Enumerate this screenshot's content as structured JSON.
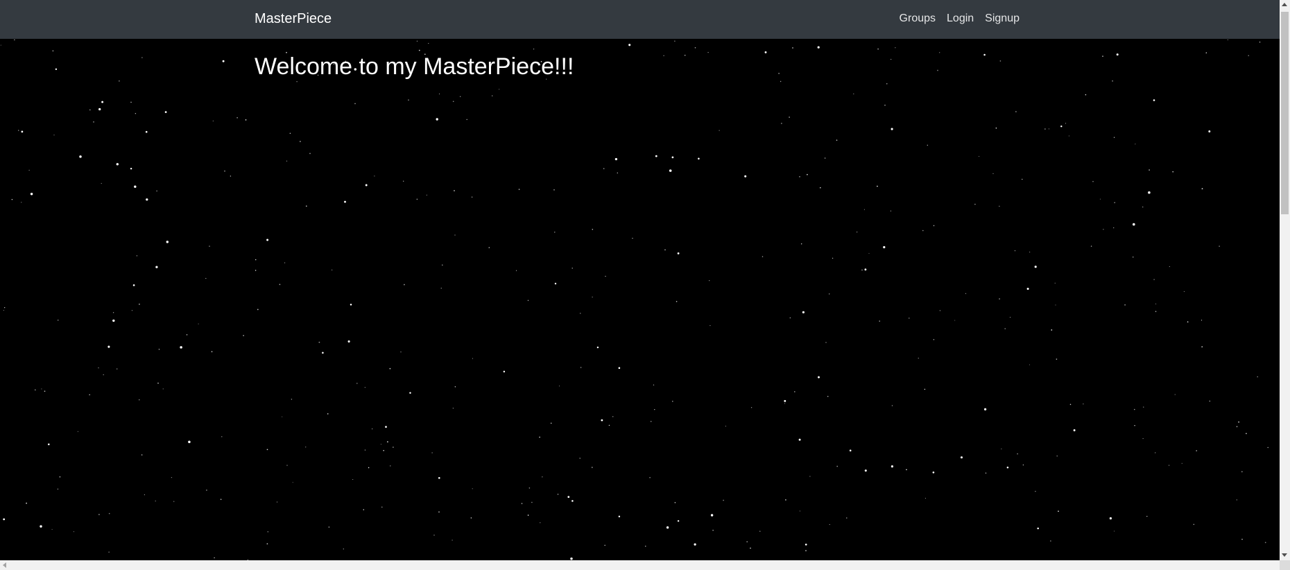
{
  "navbar": {
    "brand": "MasterPiece",
    "links": [
      "Groups",
      "Login",
      "Signup"
    ],
    "background": "#343a40"
  },
  "main": {
    "heading": "Welcome to my MasterPiece!!!",
    "background": "#000000",
    "star_color": "#ffffff"
  }
}
